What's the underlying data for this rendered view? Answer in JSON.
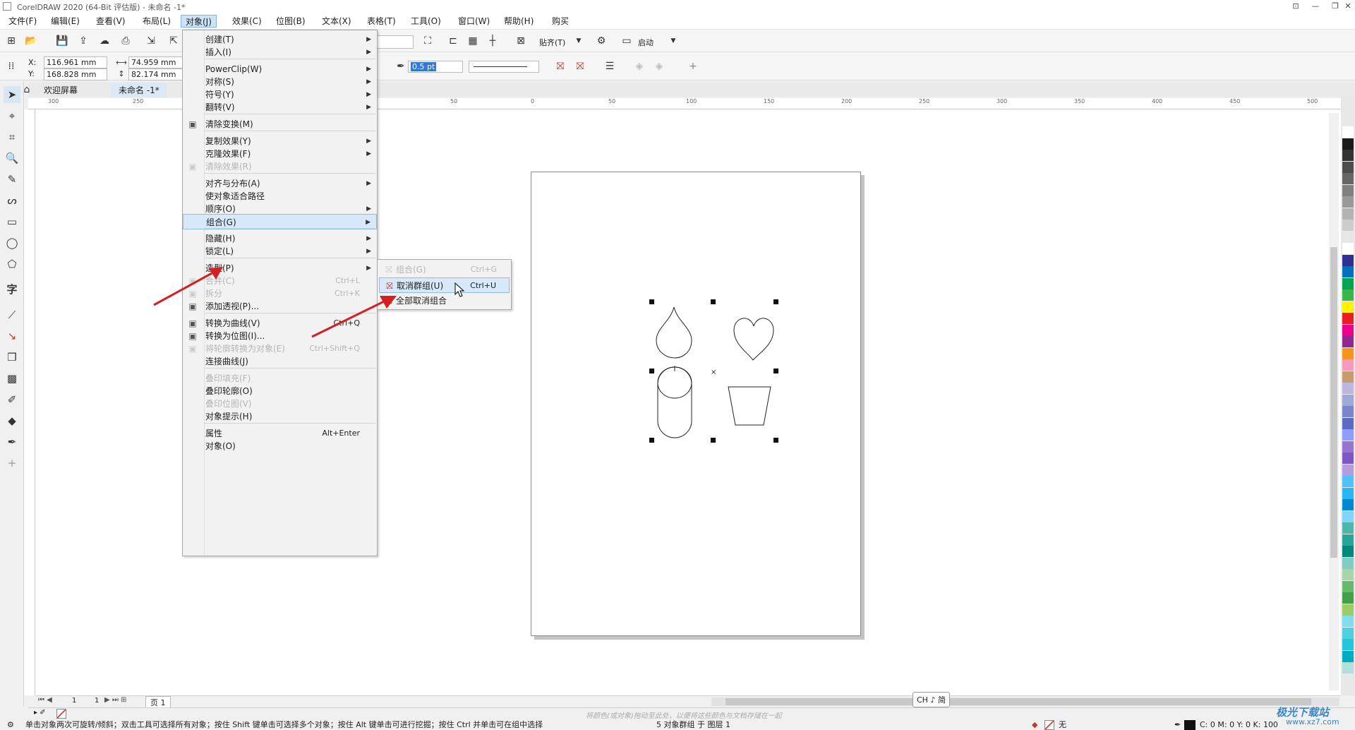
{
  "window": {
    "title": "CorelDRAW 2020 (64-Bit 评估版) - 未命名 -1*",
    "controls": [
      "minimize-icon",
      "restore-icon",
      "close-icon"
    ]
  },
  "menubar": {
    "items": [
      "文件(F)",
      "编辑(E)",
      "查看(V)",
      "布局(L)",
      "对象(J)",
      "效果(C)",
      "位图(B)",
      "文本(X)",
      "表格(T)",
      "工具(O)",
      "窗口(W)",
      "帮助(H)",
      "购买"
    ],
    "active": "对象(J)"
  },
  "toolbar": {
    "snap_label": "贴齐(T)",
    "launch_label": "启动"
  },
  "property_bar": {
    "x_label": "X:",
    "y_label": "Y:",
    "x_value": "116.961 mm",
    "y_value": "168.828 mm",
    "width_value": "74.959 mm",
    "height_value": "82.174 mm",
    "outline_width": "0.5 pt"
  },
  "doc_tabs": {
    "welcome": "欢迎屏幕",
    "document": "未命名 -1*"
  },
  "ruler_h": [
    "300",
    "250",
    "50",
    "0",
    "50",
    "100",
    "150",
    "200",
    "250",
    "300",
    "350",
    "400",
    "450",
    "500"
  ],
  "object_menu": [
    {
      "label": "创建(T)",
      "submenu": true
    },
    {
      "label": "插入(I)",
      "submenu": true
    },
    {
      "sep": true
    },
    {
      "label": "PowerClip(W)",
      "submenu": true
    },
    {
      "label": "对称(S)",
      "submenu": true
    },
    {
      "label": "符号(Y)",
      "submenu": true
    },
    {
      "label": "翻转(V)",
      "submenu": true
    },
    {
      "sep": true
    },
    {
      "label": "清除变换(M)",
      "icon": "clear-transform-icon"
    },
    {
      "sep": true
    },
    {
      "label": "复制效果(Y)",
      "submenu": true
    },
    {
      "label": "克隆效果(F)",
      "submenu": true
    },
    {
      "label": "清除效果(R)",
      "disabled": true,
      "icon": "clear-effect-icon"
    },
    {
      "sep": true
    },
    {
      "label": "对齐与分布(A)",
      "submenu": true
    },
    {
      "label": "使对象适合路径"
    },
    {
      "label": "顺序(O)",
      "submenu": true
    },
    {
      "label": "组合(G)",
      "submenu": true,
      "highlight": true
    },
    {
      "sep": true
    },
    {
      "label": "隐藏(H)",
      "submenu": true
    },
    {
      "label": "锁定(L)",
      "submenu": true
    },
    {
      "sep": true
    },
    {
      "label": "造型(P)",
      "submenu": true
    },
    {
      "label": "合并(C)",
      "shortcut": "Ctrl+L",
      "disabled": true,
      "icon": "combine-icon"
    },
    {
      "label": "拆分",
      "shortcut": "Ctrl+K",
      "disabled": true,
      "icon": "break-apart-icon"
    },
    {
      "label": "添加透视(P)...",
      "icon": "perspective-icon"
    },
    {
      "sep": true
    },
    {
      "label": "转换为曲线(V)",
      "shortcut": "Ctrl+Q",
      "icon": "convert-curve-icon"
    },
    {
      "label": "转换为位图(I)...",
      "icon": "convert-bitmap-icon"
    },
    {
      "label": "将轮廓转换为对象(E)",
      "shortcut": "Ctrl+Shift+Q",
      "disabled": true,
      "icon": "outline-object-icon"
    },
    {
      "label": "连接曲线(J)"
    },
    {
      "sep": true
    },
    {
      "label": "叠印填充(F)",
      "disabled": true
    },
    {
      "label": "叠印轮廓(O)"
    },
    {
      "label": "叠印位图(V)",
      "disabled": true
    },
    {
      "label": "对象提示(H)"
    },
    {
      "sep": true
    },
    {
      "label": "属性",
      "shortcut": "Alt+Enter"
    },
    {
      "label": "对象(O)"
    }
  ],
  "group_submenu": [
    {
      "label": "组合(G)",
      "shortcut": "Ctrl+G",
      "disabled": true
    },
    {
      "label": "取消群组(U)",
      "shortcut": "Ctrl+U",
      "highlight": true
    },
    {
      "label": "全部取消组合"
    }
  ],
  "page_nav": {
    "current": "1",
    "of": "1",
    "page_tab": "页 1"
  },
  "color_hint": "将颜色(或对象)拖动至此处，以便将这些颜色与文档存储在一起",
  "ime": "CH ♪ 简",
  "status": {
    "hint": "单击对象两次可旋转/倾斜；双击工具可选择所有对象；按住 Shift 键单击可选择多个对象；按住 Alt 键单击可进行挖掘；按住 Ctrl 并单击可在组中选择",
    "selection": "5 对象群组 于 图层 1",
    "fill_none": "无",
    "cmyk": "C: 0 M: 0 Y: 0 K: 100"
  },
  "watermark": {
    "brand": "极光下载站",
    "url": "www.xz7.com"
  },
  "palette_colors": [
    "#ffffff",
    "#1a1a1a",
    "#333333",
    "#4d4d4d",
    "#666666",
    "#808080",
    "#999999",
    "#b3b3b3",
    "#cccccc",
    "#e6e6e6",
    "#ffffff",
    "#2e3192",
    "#0072bc",
    "#00a651",
    "#39b54a",
    "#fff200",
    "#ed1c24",
    "#ec008c",
    "#92278f",
    "#f7941d",
    "#f49ac1",
    "#c69c6d",
    "#bfb5df",
    "#9fa8da",
    "#7986cb",
    "#5c6bc0",
    "#8c9eff",
    "#9575cd",
    "#7e57c2",
    "#b39ddb",
    "#4fc3f7",
    "#29b6f6",
    "#0288d1",
    "#81d4fa",
    "#4db6ac",
    "#26a69a",
    "#00897b",
    "#80cbc4",
    "#a5d6a7",
    "#66bb6a",
    "#43a047",
    "#9ccc65",
    "#80deea",
    "#4dd0e1",
    "#26c6da",
    "#00acc1",
    "#b2dfdb"
  ]
}
